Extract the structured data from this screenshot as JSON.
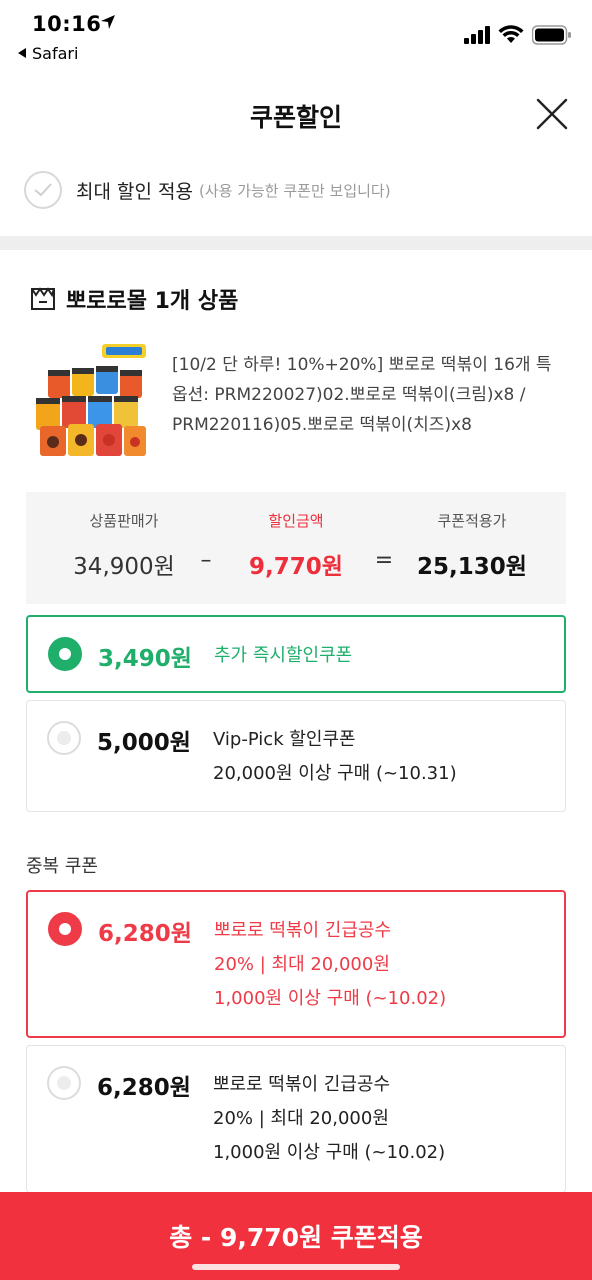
{
  "status_bar": {
    "time": "10:16",
    "back_app": "Safari"
  },
  "header": {
    "title": "쿠폰할인"
  },
  "max_discount": {
    "label": "최대 할인 적용",
    "hint": "(사용 가능한 쿠폰만 보입니다)"
  },
  "store": {
    "name": "뽀로로몰 1개 상품"
  },
  "product": {
    "title": "[10/2 단 하루! 10%+20%] 뽀로로 떡볶이 16개 특",
    "option_line1": "옵션: PRM220027)02.뽀로로 떡볶이(크림)x8 /",
    "option_line2": "PRM220116)05.뽀로로 떡볶이(치즈)x8"
  },
  "price": {
    "sale_label": "상품판매가",
    "sale_value": "34,900원",
    "discount_label": "할인금액",
    "discount_value": "9,770원",
    "final_label": "쿠폰적용가",
    "final_value": "25,130원",
    "minus": "–",
    "equals": "="
  },
  "coupons": [
    {
      "amount": "3,490원",
      "line1": "추가 즉시할인쿠폰",
      "selected": true
    },
    {
      "amount": "5,000원",
      "line1": "Vip-Pick 할인쿠폰",
      "line2": "20,000원 이상 구매 (~10.31)",
      "selected": false
    }
  ],
  "duplicate_section": {
    "label": "중복 쿠폰"
  },
  "duplicate_coupons": [
    {
      "amount": "6,280원",
      "line1": "뽀로로 떡볶이 긴급공수",
      "line2": "20% | 최대 20,000원",
      "line3": "1,000원 이상 구매 (~10.02)",
      "selected": true
    },
    {
      "amount": "6,280원",
      "line1": "뽀로로 떡볶이 긴급공수",
      "line2": "20% | 최대 20,000원",
      "line3": "1,000원 이상 구매 (~10.02)",
      "selected": false
    }
  ],
  "apply_button": {
    "label": "총 - 9,770원 쿠폰적용"
  },
  "colors": {
    "green": "#1faf6b",
    "red": "#ee3b47",
    "apply_bar": "#f1323e"
  }
}
